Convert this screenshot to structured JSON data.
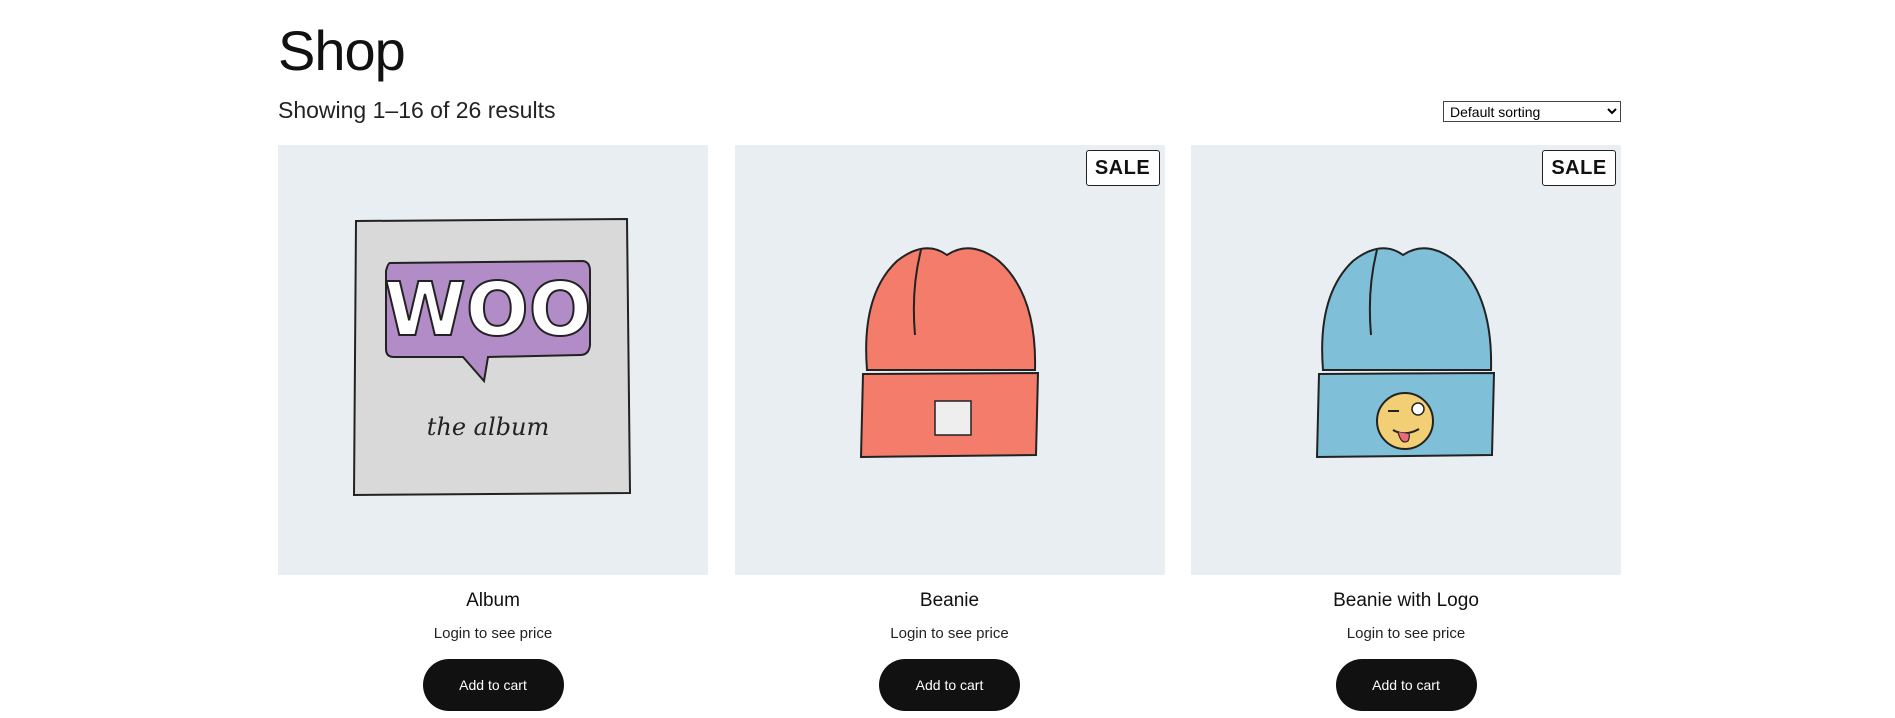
{
  "page": {
    "title": "Shop",
    "result_count": "Showing 1–16 of 26 results",
    "sort": {
      "selected": "Default sorting"
    }
  },
  "products": [
    {
      "name": "Album",
      "price_note": "Login to see price",
      "button_label": "Add to cart",
      "sale": false,
      "image": "woo-album-illustration",
      "image_text": [
        "WOO",
        "the album"
      ]
    },
    {
      "name": "Beanie",
      "price_note": "Login to see price",
      "button_label": "Add to cart",
      "sale": true,
      "sale_label": "SALE",
      "image": "orange-beanie-illustration"
    },
    {
      "name": "Beanie with Logo",
      "price_note": "Login to see price",
      "button_label": "Add to cart",
      "sale": true,
      "sale_label": "SALE",
      "image": "blue-beanie-with-emoji-illustration"
    }
  ],
  "colors": {
    "image_background": "#e8eef2",
    "button_background": "#111111",
    "button_text": "#ffffff",
    "woo_purple": "#b28cc6",
    "album_gray": "#d9d9d9",
    "orange_beanie": "#f47c6b",
    "blue_beanie": "#7fbfd8",
    "emoji_yellow": "#f2ce74"
  }
}
